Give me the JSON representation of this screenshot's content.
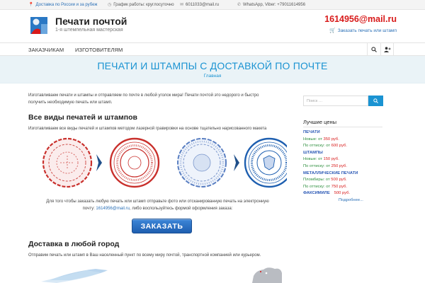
{
  "topbar": {
    "delivery": "Доставка по России и за рубеж",
    "hours": "График работы: круглосуточно",
    "email": "6011033@mail.ru",
    "messengers": "WhatsApp, Viber: +79011614956"
  },
  "header": {
    "site_title": "Печати почтой",
    "tagline": "1-я штемпельная мастерская",
    "email": "1614956@mail.ru",
    "order_link": "Заказать печать или штамп"
  },
  "nav": {
    "items": [
      "Заказчикам",
      "Изготовителям"
    ]
  },
  "banner": {
    "title": "ПЕЧАТИ И ШТАМПЫ С ДОСТАВКОЙ ПО ПОЧТЕ",
    "breadcrumb": "Главная"
  },
  "main": {
    "intro_line1": "Изготавливаем печати и штампы и отправляем по почте в любой уголок мира! Печати почтой это недорого и быстро",
    "intro_line2": "получить необходимую печать или штамп.",
    "h_all": "Все виды печатей и штампов",
    "all_text": "Изготавливаем все виды печатей и штампов методом лазерной гравировки на основе тщательно нарисованного макета",
    "order_line1": "Для того чтобы заказать любую печать или штамп отправьте фото или отсканированную печать на электронную",
    "order_line2_pre": "почту: ",
    "order_line2_email": "1614956@mail.ru",
    "order_line2_post": ", либо воспользуйтесь формой оформления заказа:",
    "order_button": "ЗАКАЗАТЬ",
    "h_delivery": "Доставка в любой город",
    "delivery_text": "Отправим печать или штамп в Ваш населенный пункт по всему миру почтой, транспортной компанией или курьером."
  },
  "sidebar": {
    "search_placeholder": "Поиск …",
    "prices_title": "Лучшие цены",
    "prices": [
      {
        "type": "cat",
        "label": "ПЕЧАТИ"
      },
      {
        "type": "item",
        "label": "Новые: от ",
        "value": "350 руб."
      },
      {
        "type": "item",
        "label": "По оттиску: от ",
        "value": "600 руб."
      },
      {
        "type": "cat",
        "label": "ШТАМПЫ"
      },
      {
        "type": "item",
        "label": "Новые: от ",
        "value": "150 руб."
      },
      {
        "type": "item",
        "label": "По оттиску: от ",
        "value": "250 руб."
      },
      {
        "type": "cat",
        "label": "МЕТАЛЛИЧЕСКИЕ ПЕЧАТИ"
      },
      {
        "type": "item",
        "label": "Пломбиры: от ",
        "value": "500 руб."
      },
      {
        "type": "item",
        "label": "По оттиску: от ",
        "value": "750 руб."
      },
      {
        "type": "catline",
        "label": "ФАКСИМИЛЕ",
        "value": "500 руб."
      },
      {
        "type": "more",
        "label": "Подробнее..."
      }
    ]
  },
  "colors": {
    "accent": "#1a93d2",
    "email_red": "#d81a1a",
    "price_green": "#2e8f3e",
    "category_blue": "#2a58b5"
  }
}
